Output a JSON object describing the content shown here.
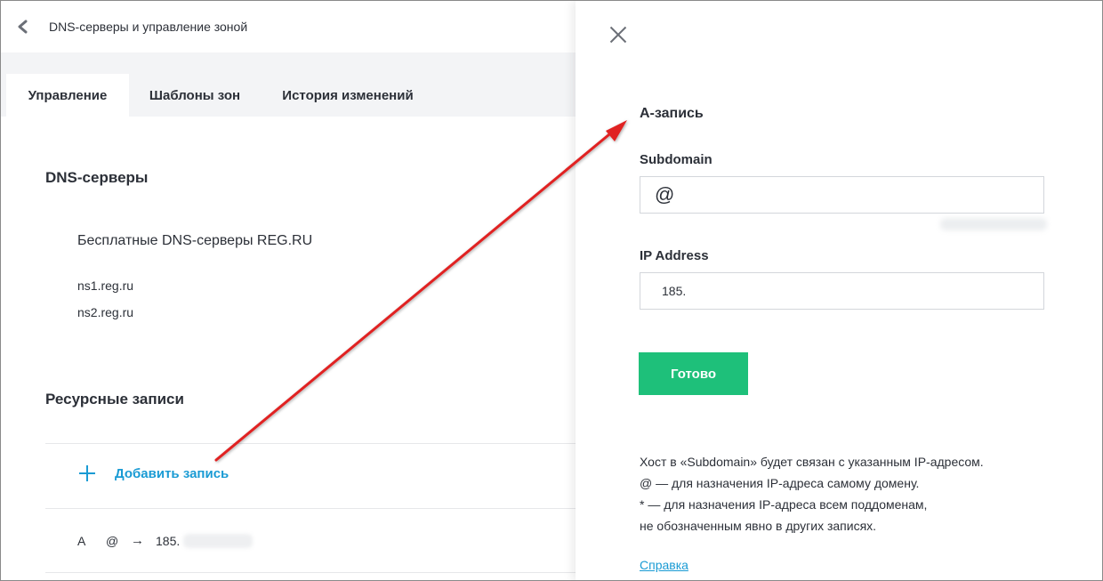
{
  "header": {
    "title": "DNS-серверы и управление зоной"
  },
  "tabs": [
    {
      "label": "Управление",
      "active": true
    },
    {
      "label": "Шаблоны зон",
      "active": false
    },
    {
      "label": "История изменений",
      "active": false
    }
  ],
  "dns_section": {
    "title": "DNS-серверы",
    "provider": "Бесплатные DNS-серверы REG.RU",
    "servers": [
      "ns1.reg.ru",
      "ns2.reg.ru"
    ]
  },
  "records_section": {
    "title": "Ресурсные записи",
    "add_label": "Добавить запись",
    "records": [
      {
        "type": "A",
        "host": "@",
        "arrow": "→",
        "value": "185."
      }
    ]
  },
  "panel": {
    "title": "А-запись",
    "subdomain_label": "Subdomain",
    "subdomain_value": "@",
    "ip_label": "IP Address",
    "ip_value": "185.",
    "submit_label": "Готово",
    "help_lines": [
      "Хост в «Subdomain» будет связан с указанным IP-адресом.",
      "@ — для назначения IP-адреса самому домену.",
      "* — для назначения IP-адреса всем поддоменам,",
      "не обозначенным явно в других записях."
    ],
    "help_link": "Справка"
  },
  "colors": {
    "accent_green": "#1ec07a",
    "link_blue": "#1a9bd4",
    "annotation_red": "#e02020",
    "tabs_bg": "#f3f4f6"
  },
  "icons": {
    "back": "chevron-left-icon",
    "add": "plus-icon",
    "close": "close-icon"
  }
}
